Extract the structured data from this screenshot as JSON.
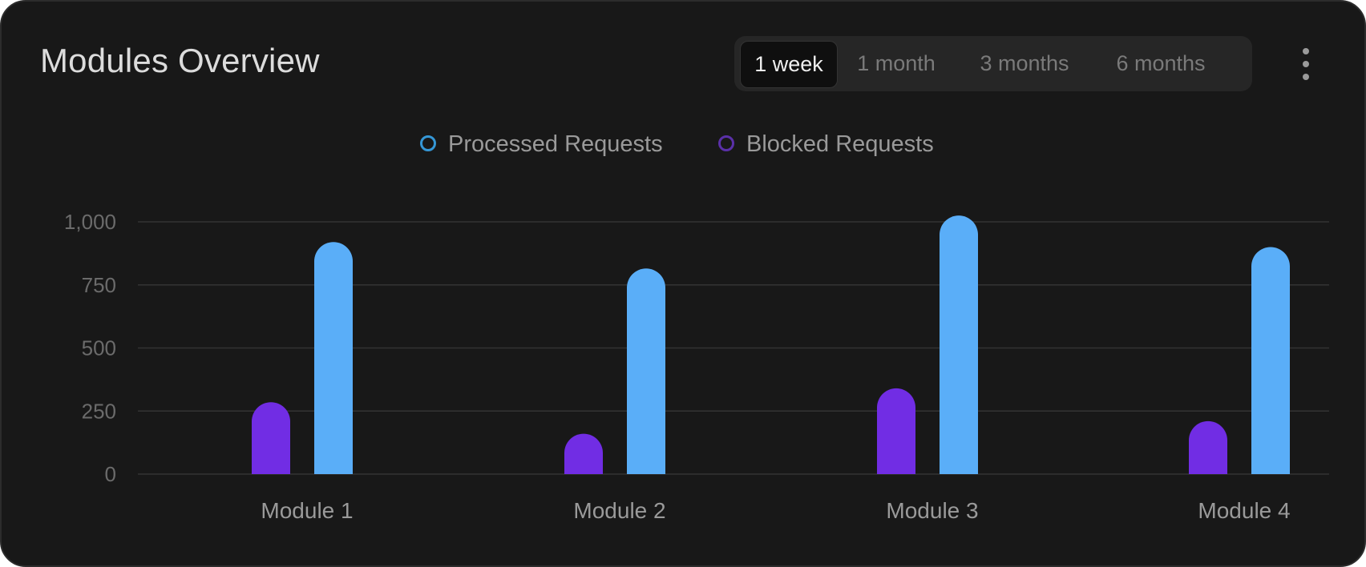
{
  "header": {
    "title": "Modules Overview",
    "ranges": [
      "1 week",
      "1 month",
      "3 months",
      "6 months"
    ],
    "selected_range": "1 week",
    "menu_icon": "kebab-menu-icon"
  },
  "colors": {
    "processed": "#5AAEF8",
    "blocked": "#712DE4",
    "processed_legend_ring": "#3597D6",
    "blocked_legend_ring": "#5A30A8",
    "grid": "#333333",
    "tick_text": "#6b6b6b",
    "category_text": "#9a9a9a",
    "legend_text": "#9a9a9a"
  },
  "chart_data": {
    "type": "bar",
    "title": "",
    "xlabel": "",
    "ylabel": "",
    "categories": [
      "Module 1",
      "Module 2",
      "Module 3",
      "Module 4"
    ],
    "series": [
      {
        "name": "Blocked Requests",
        "values": [
          285,
          160,
          340,
          210
        ]
      },
      {
        "name": "Processed Requests",
        "values": [
          920,
          815,
          1025,
          900
        ]
      }
    ],
    "legend_order": [
      "Processed Requests",
      "Blocked Requests"
    ],
    "y_ticks": [
      0,
      250,
      500,
      750,
      1000
    ],
    "y_tick_labels": [
      "0",
      "250",
      "500",
      "750",
      "1,000"
    ],
    "ylim": [
      0,
      1000
    ],
    "grid": true,
    "legend_position": "top-center"
  }
}
